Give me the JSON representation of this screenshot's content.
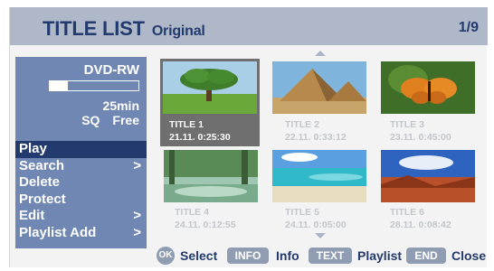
{
  "header": {
    "title": "TITLE LIST",
    "subtitle": "Original",
    "page": "1/9"
  },
  "disc": {
    "type": "DVD-RW",
    "used_fraction": 0.2,
    "free_time": "25min",
    "quality": "SQ",
    "free_label": "Free"
  },
  "menu": {
    "items": [
      {
        "label": "Play",
        "selected": true,
        "submenu": ""
      },
      {
        "label": "Search",
        "selected": false,
        "submenu": ">"
      },
      {
        "label": "Delete",
        "selected": false,
        "submenu": ""
      },
      {
        "label": "Protect",
        "selected": false,
        "submenu": ""
      },
      {
        "label": "Edit",
        "selected": false,
        "submenu": ">"
      },
      {
        "label": "Playlist Add",
        "selected": false,
        "submenu": ">"
      }
    ]
  },
  "titles": [
    {
      "name": "TITLE 1",
      "date": "21.11.",
      "time": "0:25:30",
      "selected": true,
      "scene": "tree-icon"
    },
    {
      "name": "TITLE 2",
      "date": "22.11.",
      "time": "0:33:12",
      "selected": false,
      "scene": "pyramid-icon"
    },
    {
      "name": "TITLE 3",
      "date": "23.11.",
      "time": "0:45:00",
      "selected": false,
      "scene": "butterfly-icon"
    },
    {
      "name": "TITLE 4",
      "date": "24.11.",
      "time": "0:12:55",
      "selected": false,
      "scene": "forest-icon"
    },
    {
      "name": "TITLE 5",
      "date": "24.11.",
      "time": "0:05:00",
      "selected": false,
      "scene": "beach-icon"
    },
    {
      "name": "TITLE 6",
      "date": "28.11.",
      "time": "0:08:42",
      "selected": false,
      "scene": "desert-icon"
    }
  ],
  "footer": {
    "ok_key": "OK",
    "ok_label": "Select",
    "info_key": "INFO",
    "info_label": "Info",
    "text_key": "TEXT",
    "text_label": "Playlist",
    "end_key": "END",
    "end_label": "Close"
  },
  "colors": {
    "header_bg": "#aeb8c8",
    "title_text": "#233a6e",
    "panel_bg": "#6f87b2",
    "menu_selected_bg": "#233a6e",
    "key_bg": "#8f9cb2"
  }
}
